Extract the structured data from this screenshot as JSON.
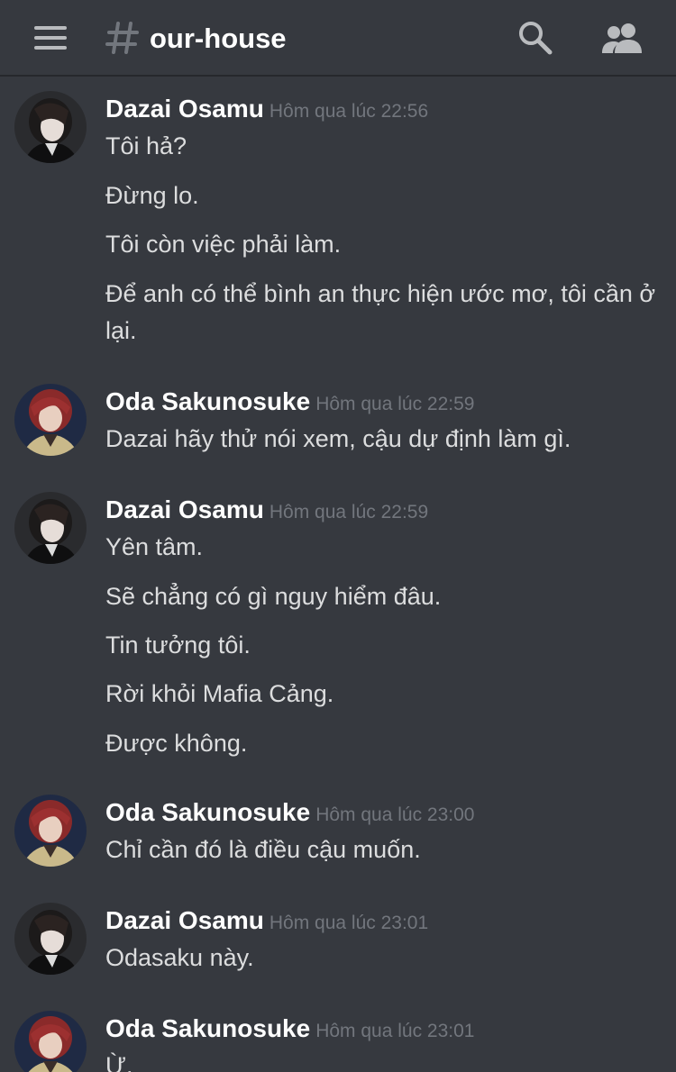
{
  "channel": {
    "name": "our-house"
  },
  "header": {
    "menu_icon": "hamburger-menu-icon",
    "hash_icon": "hash-icon",
    "search_icon": "search-icon",
    "members_icon": "members-icon"
  },
  "colors": {
    "background": "#36393f",
    "username": "#ffffff",
    "timestamp": "#72767d",
    "message_text": "#dcddde",
    "icon": "#b9bbbe"
  },
  "messages": [
    {
      "author": "Dazai Osamu",
      "time": "Hôm qua lúc 22:56",
      "lines": [
        "Tôi hả?",
        "Đừng lo.",
        "Tôi còn việc phải làm.",
        "Để anh có thể bình an thực hiện ước mơ, tôi cần ở lại."
      ]
    },
    {
      "author": "Oda Sakunosuke",
      "time": "Hôm qua lúc 22:59",
      "lines": [
        "Dazai hãy thử nói xem, cậu dự định làm gì."
      ]
    },
    {
      "author": "Dazai Osamu",
      "time": "Hôm qua lúc 22:59",
      "lines": [
        "Yên tâm.",
        "Sẽ chẳng có gì nguy hiểm đâu.",
        "Tin tưởng tôi.",
        "Rời khỏi Mafia Cảng.",
        "Được không."
      ]
    },
    {
      "author": "Oda Sakunosuke",
      "time": "Hôm qua lúc 23:00",
      "lines": [
        "Chỉ cần đó là điều cậu muốn."
      ]
    },
    {
      "author": "Dazai Osamu",
      "time": "Hôm qua lúc 23:01",
      "lines": [
        "Odasaku này."
      ]
    },
    {
      "author": "Oda Sakunosuke",
      "time": "Hôm qua lúc 23:01",
      "lines": [
        "Ừ."
      ]
    }
  ]
}
